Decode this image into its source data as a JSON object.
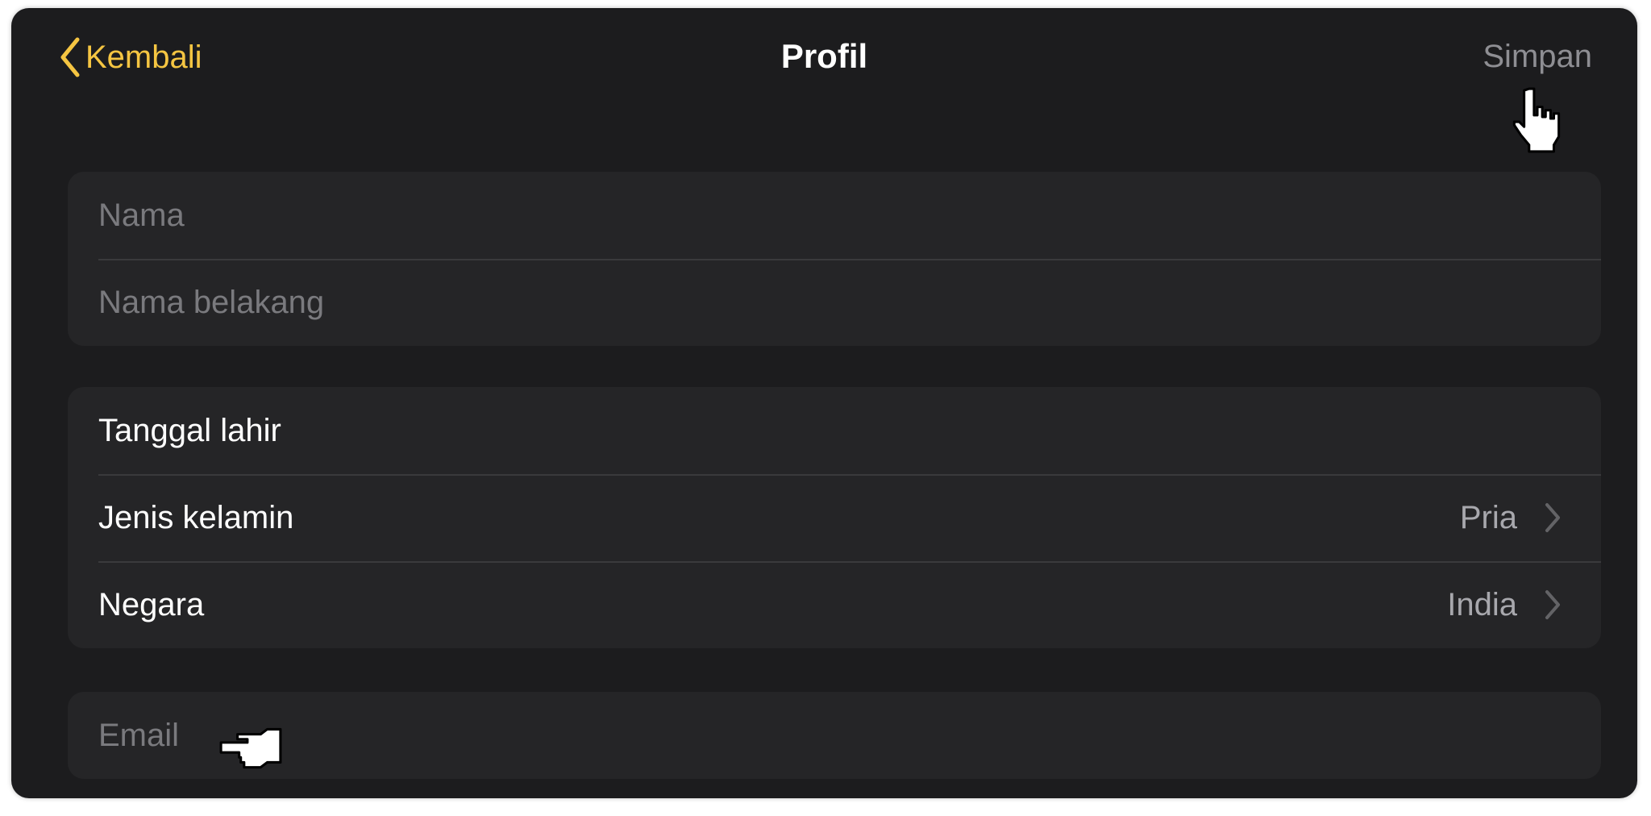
{
  "navbar": {
    "back_label": "Kembali",
    "title": "Profil",
    "save_label": "Simpan"
  },
  "name_group": {
    "first_name_placeholder": "Nama",
    "last_name_placeholder": "Nama belakang"
  },
  "details_group": {
    "birthdate_label": "Tanggal lahir",
    "gender_label": "Jenis kelamin",
    "gender_value": "Pria",
    "country_label": "Negara",
    "country_value": "India"
  },
  "contact_group": {
    "email_placeholder": "Email"
  },
  "colors": {
    "accent": "#f5c542",
    "background": "#1c1c1e",
    "cell": "#252527",
    "muted_text": "#8e8e93"
  },
  "icons": {
    "back": "chevron-left-icon",
    "disclosure": "chevron-right-icon",
    "cursor_pointer": "hand-pointer-icon"
  }
}
